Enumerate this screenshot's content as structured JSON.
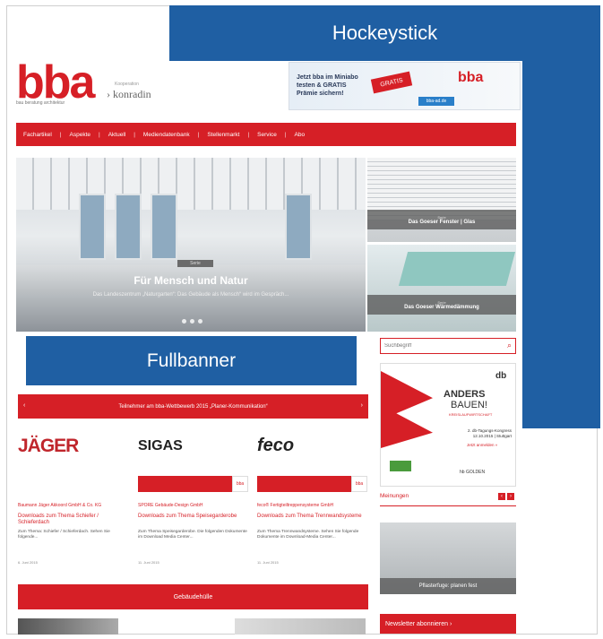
{
  "overlays": {
    "hockeystick": "Hockeystick",
    "fullbanner": "Fullbanner"
  },
  "brand": {
    "logo": "bba",
    "logo_sub": "bau  beratung  architektur",
    "partner_small": "Kooperation",
    "partner": "konradin"
  },
  "top_ad": {
    "text": "Jetzt bba im Miniabo testen & GRATIS Prämie sichern!",
    "ribbon": "GRATIS",
    "button": "bba-ad.de",
    "logo": "bba"
  },
  "nav": {
    "items": [
      "Fachartikel",
      "Aspekte",
      "Aktuell",
      "Mediendatenbank",
      "Stellenmarkt",
      "Service",
      "Abo"
    ]
  },
  "hero": {
    "tag": "Serie",
    "title": "Für Mensch und Natur",
    "subtitle": "Das Landeszentrum „Naturgarten“: Das Gebäude als Mensch“ wird im Gespräch..."
  },
  "side_features": [
    {
      "kicker": "Serie",
      "title": "Das Goeser Fenster | Glas"
    },
    {
      "kicker": "Serie",
      "title": "Das Goeser Wärmedämmung"
    }
  ],
  "search": {
    "placeholder": "Suchbegriff"
  },
  "side_ad": {
    "db": "db",
    "line1": "ANDERS",
    "line2": "BAUEN!",
    "line3": "KREISLAUFWIRTSCHAFT",
    "info": "2. db-Tagungs-Kongress 12.10.2015 | Stuttgart",
    "link": "Jetzt anmelden »",
    "bottom": "hb  GOLDEN"
  },
  "meinungen": {
    "label": "Meinungen",
    "prev": "‹",
    "next": "›"
  },
  "opinion": {
    "caption": "Pflasterfuge: planen fest"
  },
  "newsletter": {
    "label": "Newsletter abonnieren ›"
  },
  "contest": {
    "title": "Teilnehmer am bba-Wettbewerb 2015 „Planer-Kommunikation“",
    "prev": "‹",
    "next": "›"
  },
  "companies": [
    {
      "logo": "JÄGER",
      "name": "Baumann Jäger Akkoord GmbH & Co. KG",
      "title": "Downloads zum Thema Schiefer / Schieferdach",
      "desc": "Zum Thema: Schiefer / Schieferdach. Sehen Sie folgende...",
      "date": "6. Juni 2015"
    },
    {
      "logo": "SIGAS",
      "name": "SPORE Gebäude-Design GmbH",
      "title": "Downloads zum Thema Speisegarderobe",
      "desc": "Zum Thema Speisegarderobe. Die folgenden Dokumente im Download Media Center...",
      "date": "11. Juni 2015"
    },
    {
      "logo": "feco",
      "name": "feco® Fertigteiltreppensysteme GmbH",
      "title": "Downloads zum Thema Trennwandsysteme",
      "desc": "Zum Thema Trennwandsysteme. Sehen Sie folgende Dokumente im Download-Media Center...",
      "date": "11. Juni 2015"
    }
  ],
  "section2": {
    "title": "Gebäudehülle"
  }
}
